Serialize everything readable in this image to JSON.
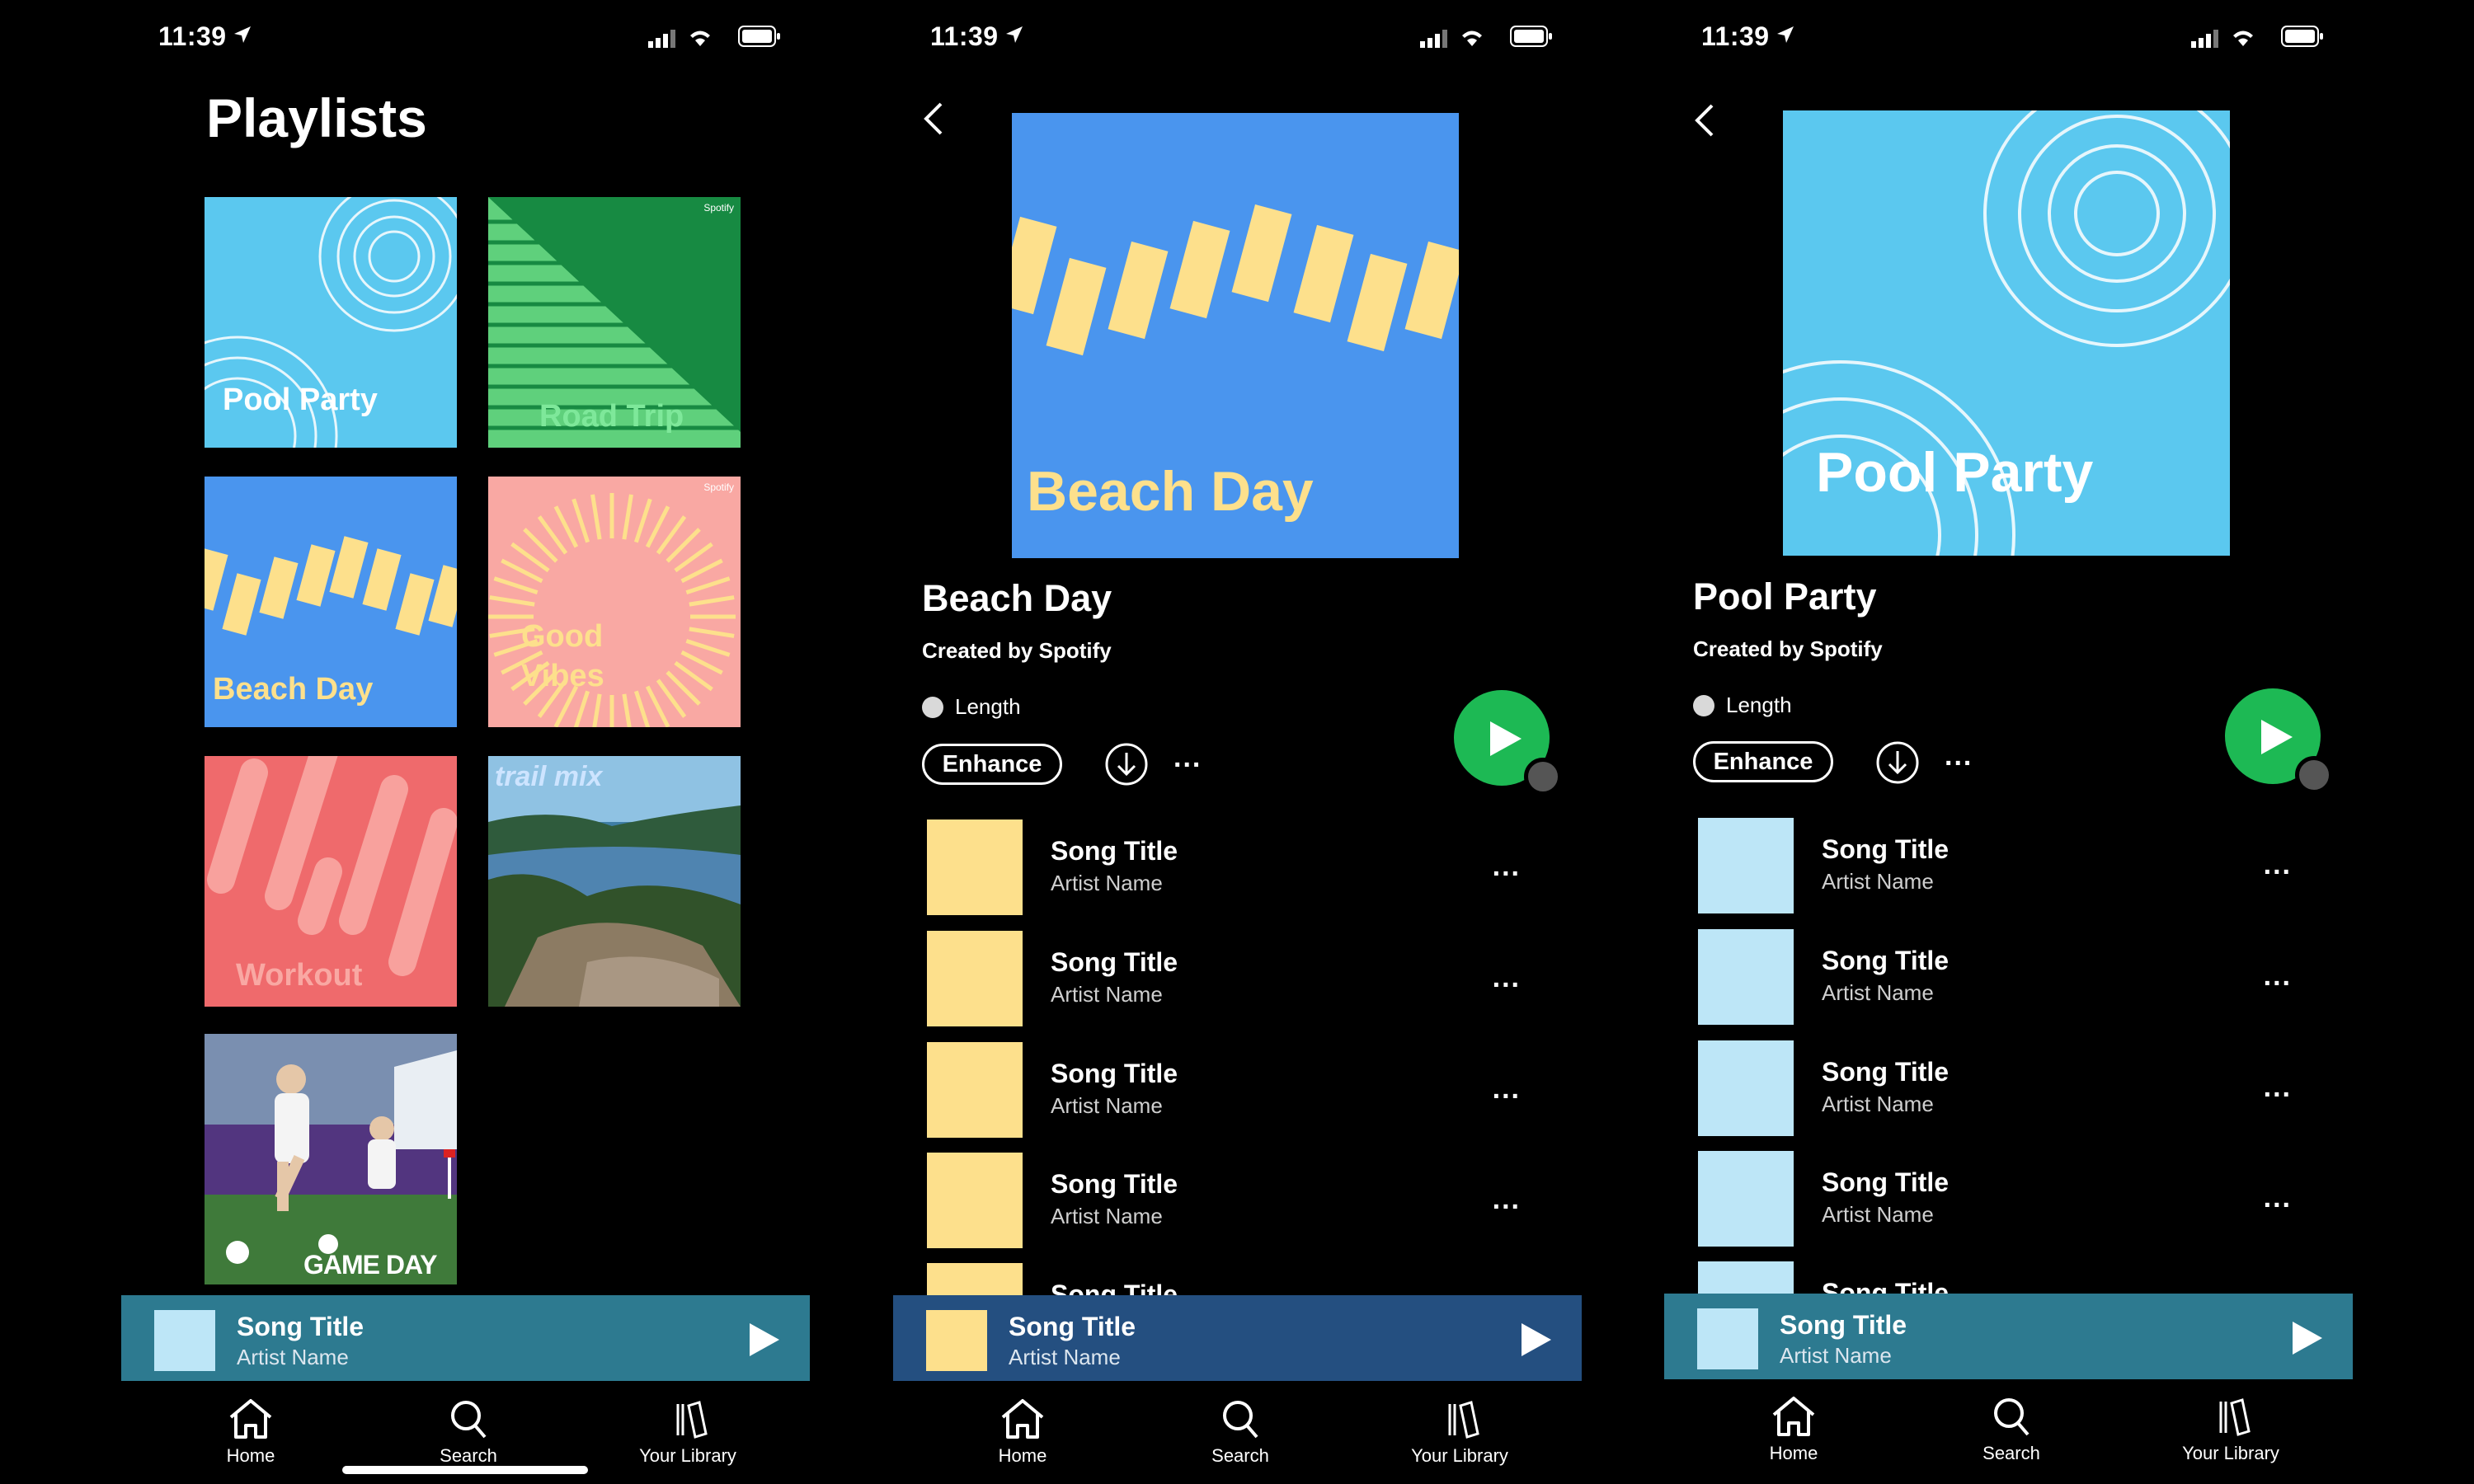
{
  "status_bar": {
    "time": "11:39"
  },
  "screen_library": {
    "title": "Playlists",
    "tiles": [
      {
        "label": "Pool Party",
        "color": "#5bc8ef"
      },
      {
        "label": "Road Trip",
        "color": "#178a42",
        "brand": "Spotify"
      },
      {
        "label": "Beach Day",
        "color": "#4a95ee"
      },
      {
        "label": "Good\nVibes",
        "color": "#f9a8a3",
        "brand": "Spotify"
      },
      {
        "label": "Workout",
        "color": "#ef6a6c"
      },
      {
        "label": "trail mix",
        "color": "#3f7ea6"
      },
      {
        "label": "GAME DAY",
        "color": "#5b3f86"
      }
    ]
  },
  "screen_beach": {
    "cover_label": "Beach Day",
    "title": "Beach Day",
    "creator": "Created by Spotify",
    "length_label": "Length",
    "enhance_label": "Enhance",
    "more_label": "...",
    "songs": [
      {
        "title": "Song Title",
        "artist": "Artist Name"
      },
      {
        "title": "Song Title",
        "artist": "Artist Name"
      },
      {
        "title": "Song Title",
        "artist": "Artist Name"
      },
      {
        "title": "Song Title",
        "artist": "Artist Name"
      },
      {
        "title": "Song Title",
        "artist": ""
      }
    ],
    "art_color": "#fde08c"
  },
  "screen_pool": {
    "cover_label": "Pool Party",
    "title": "Pool Party",
    "creator": "Created by Spotify",
    "length_label": "Length",
    "enhance_label": "Enhance",
    "more_label": "...",
    "songs": [
      {
        "title": "Song Title",
        "artist": "Artist Name"
      },
      {
        "title": "Song Title",
        "artist": "Artist Name"
      },
      {
        "title": "Song Title",
        "artist": "Artist Name"
      },
      {
        "title": "Song Title",
        "artist": "Artist Name"
      },
      {
        "title": "Song Title",
        "artist": ""
      }
    ],
    "art_color": "#bde6f7"
  },
  "mini_players": [
    {
      "title": "Song Title",
      "artist": "Artist Name",
      "bg": "#2d7a90",
      "art": "#bde6f7"
    },
    {
      "title": "Song Title",
      "artist": "Artist Name",
      "bg": "#244f80",
      "art": "#fde08c"
    },
    {
      "title": "Song Title",
      "artist": "Artist Name",
      "bg": "#2d7a90",
      "art": "#bde6f7"
    }
  ],
  "nav": {
    "home": "Home",
    "search": "Search",
    "library": "Your Library"
  },
  "icons": [
    "location-arrow-icon",
    "signal-icon",
    "wifi-icon",
    "battery-icon",
    "back-chevron-icon",
    "download-icon",
    "more-icon",
    "play-icon",
    "home-icon",
    "search-icon",
    "library-icon"
  ]
}
